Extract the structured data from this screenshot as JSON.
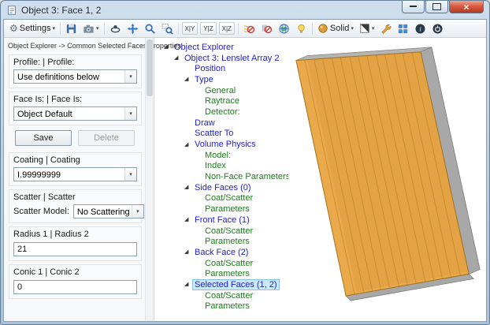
{
  "window": {
    "title": "Object 3: Face 1, 2",
    "controls": {
      "minimize": "–",
      "close": "×"
    }
  },
  "icons": {
    "gear": "⚙",
    "caret": "▾",
    "expand_arrow": "◢"
  },
  "toolbar": {
    "settings_label": "Settings",
    "solid_label": "Solid",
    "axis_views": [
      "X|Y",
      "Y|Z",
      "X|Z"
    ]
  },
  "left_panel": {
    "header": "Object Explorer ->  Common Selected Faces Properties",
    "profile": {
      "label": "Profile: | Profile:",
      "value": "Use definitions below"
    },
    "face_is": {
      "label": "Face Is: | Face Is:",
      "value": "Object Default"
    },
    "buttons": {
      "save": "Save",
      "delete": "Delete"
    },
    "coating": {
      "label": "Coating | Coating",
      "value": "I.99999999"
    },
    "scatter": {
      "label": "Scatter | Scatter",
      "model_label": "Scatter Model:",
      "model_value": "No Scattering"
    },
    "radius": {
      "label": "Radius 1 | Radius 2",
      "value": "21"
    },
    "conic": {
      "label": "Conic 1 | Conic 2",
      "value": "0"
    }
  },
  "tree": {
    "items": [
      {
        "label": "Object Explorer",
        "indent": 0,
        "kind": "branch",
        "arrow": true,
        "selected": false
      },
      {
        "label": "Object 3: Lenslet Array 2",
        "indent": 1,
        "kind": "branch",
        "arrow": true,
        "selected": false
      },
      {
        "label": "Position",
        "indent": 2,
        "kind": "branch",
        "arrow": false,
        "selected": false
      },
      {
        "label": "Type",
        "indent": 2,
        "kind": "branch",
        "arrow": true,
        "selected": false
      },
      {
        "label": "General",
        "indent": 3,
        "kind": "leaf",
        "arrow": false,
        "selected": false
      },
      {
        "label": "Raytrace",
        "indent": 3,
        "kind": "leaf",
        "arrow": false,
        "selected": false
      },
      {
        "label": "Detector:",
        "indent": 3,
        "kind": "leaf",
        "arrow": false,
        "selected": false
      },
      {
        "label": "Draw",
        "indent": 2,
        "kind": "branch",
        "arrow": false,
        "selected": false
      },
      {
        "label": "Scatter To",
        "indent": 2,
        "kind": "branch",
        "arrow": false,
        "selected": false
      },
      {
        "label": "Volume Physics",
        "indent": 2,
        "kind": "branch",
        "arrow": true,
        "selected": false
      },
      {
        "label": "Model:",
        "indent": 3,
        "kind": "leaf",
        "arrow": false,
        "selected": false
      },
      {
        "label": "Index",
        "indent": 3,
        "kind": "leaf",
        "arrow": false,
        "selected": false
      },
      {
        "label": "Non-Face Parameters",
        "indent": 3,
        "kind": "leaf",
        "arrow": false,
        "selected": false
      },
      {
        "label": "Side Faces (0)",
        "indent": 2,
        "kind": "branch",
        "arrow": true,
        "selected": false
      },
      {
        "label": "Coat/Scatter",
        "indent": 3,
        "kind": "leaf",
        "arrow": false,
        "selected": false
      },
      {
        "label": "Parameters",
        "indent": 3,
        "kind": "leaf",
        "arrow": false,
        "selected": false
      },
      {
        "label": "Front Face (1)",
        "indent": 2,
        "kind": "branch",
        "arrow": true,
        "selected": false
      },
      {
        "label": "Coat/Scatter",
        "indent": 3,
        "kind": "leaf",
        "arrow": false,
        "selected": false
      },
      {
        "label": "Parameters",
        "indent": 3,
        "kind": "leaf",
        "arrow": false,
        "selected": false
      },
      {
        "label": "Back Face (2)",
        "indent": 2,
        "kind": "branch",
        "arrow": true,
        "selected": false
      },
      {
        "label": "Coat/Scatter",
        "indent": 3,
        "kind": "leaf",
        "arrow": false,
        "selected": false
      },
      {
        "label": "Parameters",
        "indent": 3,
        "kind": "leaf",
        "arrow": false,
        "selected": false
      },
      {
        "label": "Selected Faces (1, 2)",
        "indent": 2,
        "kind": "branch",
        "arrow": true,
        "selected": true
      },
      {
        "label": "Coat/Scatter",
        "indent": 3,
        "kind": "leaf",
        "arrow": false,
        "selected": false
      },
      {
        "label": "Parameters",
        "indent": 3,
        "kind": "leaf",
        "arrow": false,
        "selected": false
      }
    ]
  },
  "colors": {
    "tree_branch": "#2222cc",
    "tree_leaf": "#1e7d1e",
    "selection_bg": "#cbe8f6",
    "selection_border": "#8ac2e8",
    "slab_front": "#e8a23c",
    "slab_back": "#9b9b9b",
    "slab_side": "#a8a8a8",
    "slab_top": "#b5b5b5"
  }
}
